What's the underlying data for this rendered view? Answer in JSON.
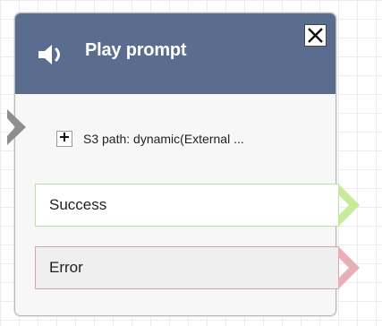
{
  "block": {
    "title": "Play prompt",
    "header_icon": "speaker-icon",
    "close_icon": "close-icon",
    "colors": {
      "header": "#5b6d8e",
      "success_border": "#b8e0a0",
      "success_arrow": "#c6ec9a",
      "error_border": "#d8a4a8",
      "error_arrow": "#e6b0b6"
    }
  },
  "parameters": {
    "s3_path": "S3 path: dynamic(External ..."
  },
  "branches": {
    "success": "Success",
    "error": "Error"
  }
}
